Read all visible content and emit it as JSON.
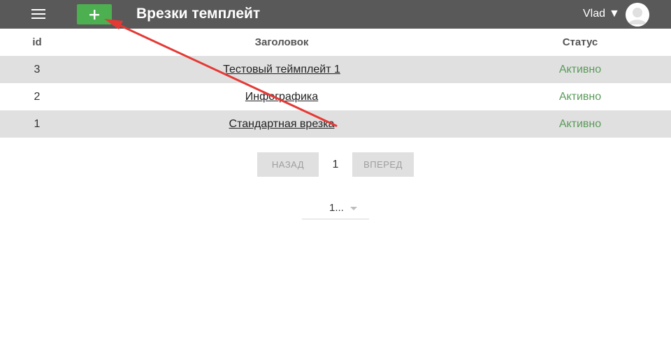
{
  "header": {
    "title": "Врезки темплейт",
    "add_label": "+",
    "user_name": "Vlad",
    "user_caret": "▼"
  },
  "table": {
    "columns": [
      "id",
      "Заголовок",
      "Статус"
    ],
    "rows": [
      {
        "id": "3",
        "title": "Тестовый теймплейт 1",
        "status": "Активно"
      },
      {
        "id": "2",
        "title": "Инфографика",
        "status": "Активно"
      },
      {
        "id": "1",
        "title": "Стандартная врезка",
        "status": "Активно"
      }
    ]
  },
  "pagination": {
    "prev_label": "НАЗАД",
    "current_page": "1",
    "next_label": "ВПЕРЕД"
  },
  "per_page": {
    "selected": "1..."
  },
  "colors": {
    "header_bg": "#595959",
    "add_button": "#4caf50",
    "status_active": "#5a9b5a",
    "row_shade": "#e0e0e0",
    "annotation_arrow": "#e53935"
  }
}
